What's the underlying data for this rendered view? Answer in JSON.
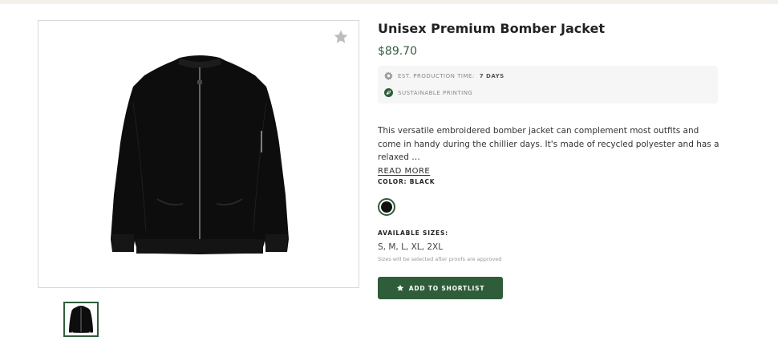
{
  "product": {
    "title": "Unisex Premium Bomber Jacket",
    "price": "$89.70",
    "image_alt": "black bomber jacket"
  },
  "badges": {
    "production_label": "EST. PRODUCTION TIME:",
    "production_value": "7 DAYS",
    "production_icon": "gear-icon",
    "sustainable_label": "SUSTAINABLE PRINTING",
    "sustainable_icon": "leaf-icon"
  },
  "description": {
    "text": "This versatile embroidered bomber jacket can complement most outfits and come in handy during the chillier days. It's made of recycled polyester and has a relaxed …",
    "read_more": "READ MORE"
  },
  "color": {
    "label": "COLOR: BLACK",
    "selected_hex": "#111111"
  },
  "sizes": {
    "label": "AVAILABLE SIZES:",
    "values": "S, M, L, XL, 2XL",
    "note": "Sizes will be selected after proofs are approved"
  },
  "actions": {
    "shortlist_label": "ADD TO SHORTLIST",
    "shortlist_icon": "star-icon",
    "favorite_icon": "star-icon"
  },
  "theme": {
    "accent": "#2f5d3a",
    "topbar": "#f4f1ec"
  }
}
